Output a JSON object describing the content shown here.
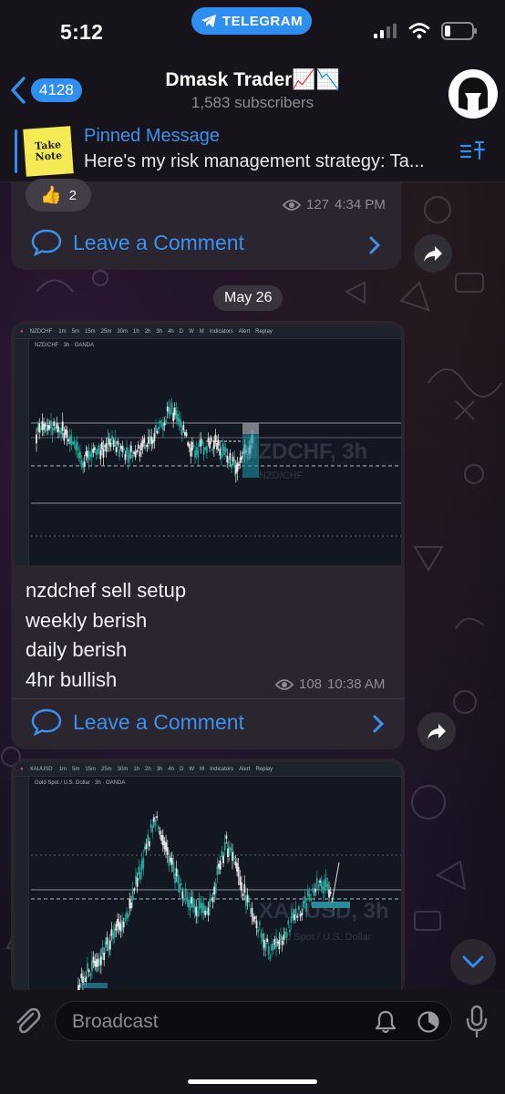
{
  "status_bar": {
    "time": "5:12",
    "app_pill": "TELEGRAM"
  },
  "header": {
    "back_count": "4128",
    "channel_name": "Dmask Trader📈📉",
    "subscribers": "1,583 subscribers"
  },
  "pinned": {
    "title": "Pinned Message",
    "text": "Here's my risk management strategy: Ta...",
    "thumb_text": "Take Note"
  },
  "messages": [
    {
      "reaction_emoji": "👍",
      "reaction_count": "2",
      "views": "127",
      "time": "4:34 PM",
      "comment_label": "Leave a Comment"
    },
    {
      "date_separator": "May 26",
      "chart": {
        "symbol": "NZDCHF",
        "info": "NZD/CHF · 3h · OANDA",
        "watermark": "NZDCHF, 3h",
        "watermark_sub": "NZD/CHF",
        "toolbar": [
          "1m",
          "5m",
          "15m",
          "25m",
          "30m",
          "1h",
          "2h",
          "3h",
          "4h",
          "D",
          "W",
          "M",
          "Indicators",
          "Alert",
          "Replay"
        ]
      },
      "text_lines": [
        "nzdchef sell setup",
        "weekly berish",
        "daily berish",
        "4hr bullish"
      ],
      "views": "108",
      "time": "10:38 AM",
      "comment_label": "Leave a Comment"
    },
    {
      "chart": {
        "symbol": "XAUUSD",
        "info": "Gold Spot / U.S. Dollar · 3h · OANDA",
        "watermark": "XAUUSD, 3h",
        "watermark_sub": "Gold Spot / U.S. Dollar",
        "toolbar": [
          "1m",
          "5m",
          "15m",
          "25m",
          "30m",
          "1h",
          "2h",
          "3h",
          "4h",
          "D",
          "W",
          "M",
          "Indicators",
          "Alert",
          "Replay"
        ]
      }
    }
  ],
  "composer": {
    "placeholder": "Broadcast"
  },
  "colors": {
    "accent": "#2f8ff0",
    "link": "#3b92ee",
    "candle_up": "#26a69a",
    "candle_down": "#ffffff",
    "bubble": "#2c2630"
  }
}
